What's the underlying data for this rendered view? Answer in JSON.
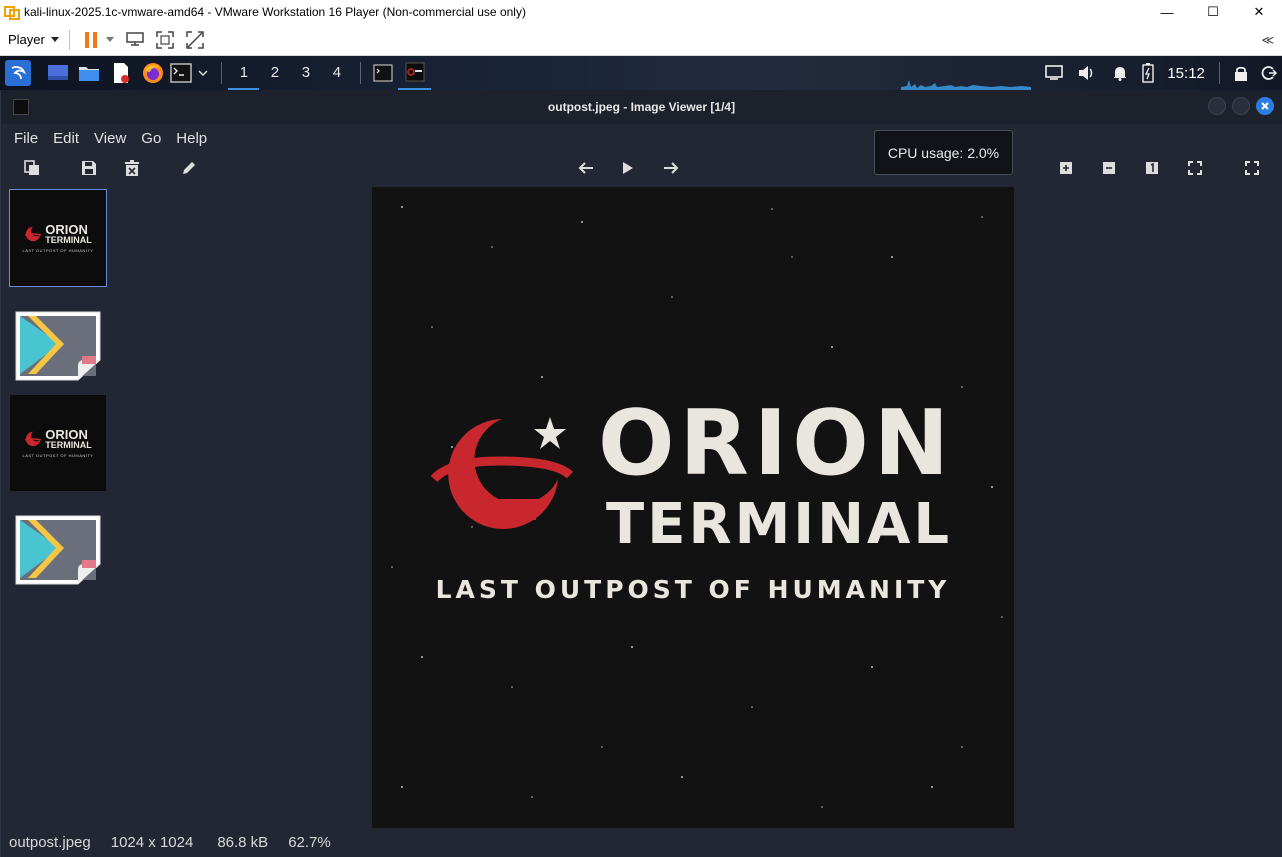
{
  "vmware": {
    "window_title": "kali-linux-2025.1c-vmware-amd64 - VMware Workstation 16 Player (Non-commercial use only)",
    "player_menu": "Player",
    "controls": {
      "minimize": "—",
      "maximize": "☐",
      "close": "✕"
    },
    "collapse_label": "≪"
  },
  "panel": {
    "workspaces": [
      "1",
      "2",
      "3",
      "4"
    ],
    "active_workspace": "1",
    "clock": "15:12"
  },
  "viewer": {
    "title": "outpost.jpeg - Image Viewer [1/4]",
    "menu": [
      "File",
      "Edit",
      "View",
      "Go",
      "Help"
    ],
    "tooltip": "CPU usage: 2.0%",
    "status": {
      "filename": "outpost.jpeg",
      "dimensions": "1024 x 1024",
      "size": "86.8 kB",
      "zoom": "62.7%"
    },
    "thumbnails": [
      {
        "kind": "logo",
        "selected": true,
        "line1": "ORION",
        "line2": "TERMINAL",
        "line3": "LAST OUTPOST OF HUMANITY"
      },
      {
        "kind": "file-icon",
        "selected": false
      },
      {
        "kind": "logo",
        "selected": false,
        "line1": "ORION",
        "line2": "TERMINAL",
        "line3": "LAST OUTPOST OF HUMANITY"
      },
      {
        "kind": "file-icon",
        "selected": false
      }
    ],
    "image": {
      "line1": "ORION",
      "line2": "TERMINAL",
      "tagline": "LAST OUTPOST OF HUMANITY",
      "logo_color": "#c8282d",
      "text_color": "#e9e6df",
      "background": "#131212"
    }
  },
  "colors": {
    "accent": "#3a8ee6",
    "viewer_bg": "#232733"
  }
}
